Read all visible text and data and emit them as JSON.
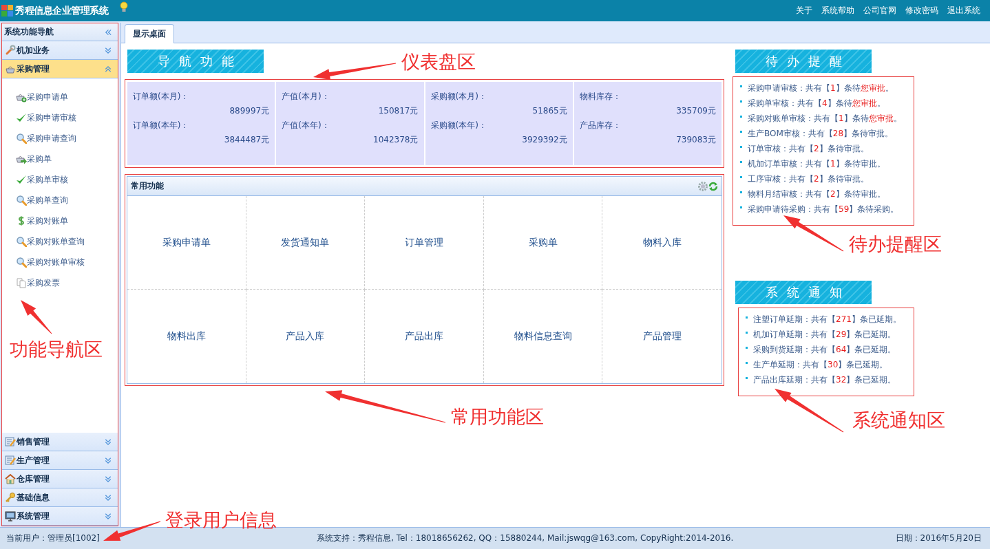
{
  "header": {
    "title": "秀程信息企业管理系统",
    "links": [
      "关于",
      "系统帮助",
      "公司官网",
      "修改密码",
      "退出系统"
    ]
  },
  "sidebar": {
    "title": "系统功能导航",
    "sections": [
      {
        "label": "机加业务",
        "kind": "wrench",
        "expanded": false
      },
      {
        "label": "采购管理",
        "kind": "basket",
        "expanded": true,
        "items": [
          {
            "label": "采购申请单",
            "kind": "basket-add"
          },
          {
            "label": "采购申请审核",
            "kind": "check"
          },
          {
            "label": "采购申请查询",
            "kind": "search"
          },
          {
            "label": "采购单",
            "kind": "basket-arrow"
          },
          {
            "label": "采购单审核",
            "kind": "check"
          },
          {
            "label": "采购单查询",
            "kind": "search"
          },
          {
            "label": "采购对账单",
            "kind": "dollar"
          },
          {
            "label": "采购对账单查询",
            "kind": "search"
          },
          {
            "label": "采购对账单审核",
            "kind": "search"
          },
          {
            "label": "采购发票",
            "kind": "document"
          }
        ]
      },
      {
        "label": "销售管理",
        "kind": "form",
        "expanded": false
      },
      {
        "label": "生产管理",
        "kind": "form",
        "expanded": false
      },
      {
        "label": "仓库管理",
        "kind": "house",
        "expanded": false
      },
      {
        "label": "基础信息",
        "kind": "key",
        "expanded": false
      },
      {
        "label": "系统管理",
        "kind": "monitor",
        "expanded": false
      }
    ]
  },
  "tabs": [
    {
      "label": "显示桌面",
      "selected": true
    }
  ],
  "nav_banner": "导航功能",
  "dashboard": [
    {
      "label_1": "订单额(本月)：",
      "value_1": "889997元",
      "label_2": "订单额(本年)：",
      "value_2": "3844487元"
    },
    {
      "label_1": "产值(本月)：",
      "value_1": "150817元",
      "label_2": "产值(本年)：",
      "value_2": "1042378元"
    },
    {
      "label_1": "采购额(本月)：",
      "value_1": "51865元",
      "label_2": "采购额(本年)：",
      "value_2": "3929392元"
    },
    {
      "label_1": "物料库存：",
      "value_1": "335709元",
      "label_2": "产品库存：",
      "value_2": "739083元"
    }
  ],
  "common": {
    "title": "常用功能",
    "items": [
      "采购申请单",
      "发货通知单",
      "订单管理",
      "采购单",
      "物料入库",
      "物料出库",
      "产品入库",
      "产品出库",
      "物料信息查询",
      "产品管理"
    ]
  },
  "todo": {
    "title": "待办提醒",
    "items": [
      {
        "label": "采购申请审核：共有【",
        "count": "1",
        "tail": "】条待",
        "alert": "您审批",
        "end": "。"
      },
      {
        "label": "采购单审核：共有【",
        "count": "4",
        "tail": "】条待",
        "alert": "您审批",
        "end": "。"
      },
      {
        "label": "采购对账单审核：共有【",
        "count": "1",
        "tail": "】条待",
        "alert": "您审批",
        "end": "。"
      },
      {
        "label": "生产BOM审核：共有【",
        "count": "28",
        "tail": "】条待审批。"
      },
      {
        "label": "订单审核：共有【",
        "count": "2",
        "tail": "】条待审批。"
      },
      {
        "label": "机加订单审核：共有【",
        "count": "1",
        "tail": "】条待审批。"
      },
      {
        "label": "工序审核：共有【",
        "count": "2",
        "tail": "】条待审批。"
      },
      {
        "label": "物料月结审核：共有【",
        "count": "2",
        "tail": "】条待审批。"
      },
      {
        "label": "采购申请待采购：共有【",
        "count": "59",
        "tail": "】条待采购。"
      }
    ]
  },
  "notice": {
    "title": "系统通知",
    "items": [
      {
        "label": "注塑订单延期：共有【",
        "count": "271",
        "tail": "】条已延期。"
      },
      {
        "label": "机加订单延期：共有【",
        "count": "29",
        "tail": "】条已延期。"
      },
      {
        "label": "采购到货延期：共有【",
        "count": "64",
        "tail": "】条已延期。"
      },
      {
        "label": "生产单延期：共有【",
        "count": "30",
        "tail": "】条已延期。"
      },
      {
        "label": "产品出库延期：共有【",
        "count": "32",
        "tail": "】条已延期。"
      }
    ]
  },
  "status_bar": {
    "user_label": "当前用户：",
    "user": "管理员[1002]",
    "support": "系统支持：秀程信息, Tel：18018656262, QQ：15880244, Mail:jswqg@163.com, CopyRight:2014-2016.",
    "date": "日期：2016年5月20日"
  },
  "annotations": [
    "仪表盘区",
    "待办提醒区",
    "功能导航区",
    "常用功能区",
    "系统通知区",
    "登录用户信息"
  ]
}
